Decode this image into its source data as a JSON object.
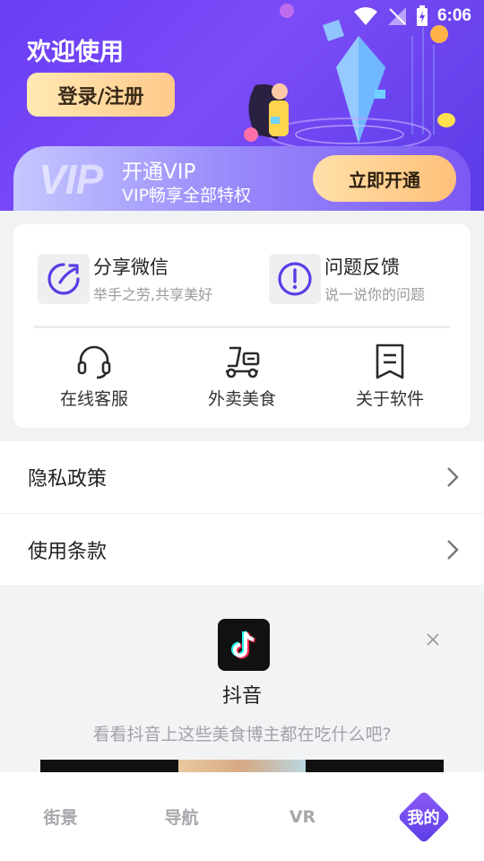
{
  "status_bar": {
    "time": "6:06"
  },
  "header": {
    "welcome": "欢迎使用",
    "login_label": "登录/注册"
  },
  "vip": {
    "logo_text": "VIP",
    "title": "开通VIP",
    "subtitle": "VIP畅享全部特权",
    "button_label": "立即开通"
  },
  "features": [
    {
      "title": "分享微信",
      "subtitle": "举手之劳,共享美好",
      "icon": "share-icon"
    },
    {
      "title": "问题反馈",
      "subtitle": "说一说你的问题",
      "icon": "feedback-icon"
    }
  ],
  "quick_actions": [
    {
      "label": "在线客服",
      "icon": "headset-icon"
    },
    {
      "label": "外卖美食",
      "icon": "delivery-scooter-icon"
    },
    {
      "label": "关于软件",
      "icon": "about-document-icon"
    }
  ],
  "list_rows": [
    {
      "label": "隐私政策"
    },
    {
      "label": "使用条款"
    }
  ],
  "ad": {
    "app_name": "抖音",
    "description": "看看抖音上这些美食博主都在吃什么吧?"
  },
  "bottom_nav": {
    "items": [
      "街景",
      "导航",
      "VR",
      "我的"
    ],
    "active": "我的"
  },
  "colors": {
    "primary_purple": "#6a3df5",
    "vip_gold": "#ffc98a"
  }
}
